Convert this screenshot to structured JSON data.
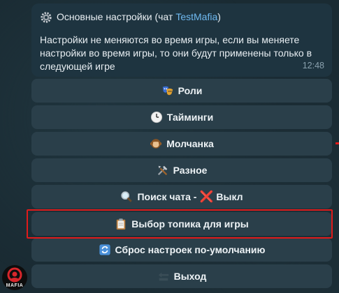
{
  "message": {
    "title_prefix": "Основные настройки (чат",
    "chat_name": "TestMafia",
    "title_suffix": ")",
    "body": "Настройки не меняются во время игры, если вы меняете настройки во время игры, то они будут применены только в следующей игре",
    "time": "12:48"
  },
  "keyboard": {
    "buttons": [
      {
        "label": "Роли",
        "icon": "masks-icon"
      },
      {
        "label": "Тайминги",
        "icon": "clock-icon"
      },
      {
        "label": "Молчанка",
        "icon": "monkey-icon"
      },
      {
        "label": "Разное",
        "icon": "tools-icon"
      },
      {
        "label_prefix": "Поиск чата -",
        "label_suffix": "Выкл",
        "icon": "magnifier-icon",
        "cross": "❌"
      },
      {
        "label": "Выбор топика для игры",
        "icon": "clipboard-icon"
      },
      {
        "label": "Сброс настроек по-умолчанию",
        "icon": "refresh-icon"
      },
      {
        "label": "Выход",
        "icon": "back-arrow-icon"
      }
    ]
  },
  "avatar": {
    "text": "MAFIA"
  },
  "colors": {
    "background": "#1a2b33",
    "bubble": "#1e3440",
    "button": "#2a3f4a",
    "link": "#6fb9f0",
    "highlight": "#e01b1b"
  }
}
